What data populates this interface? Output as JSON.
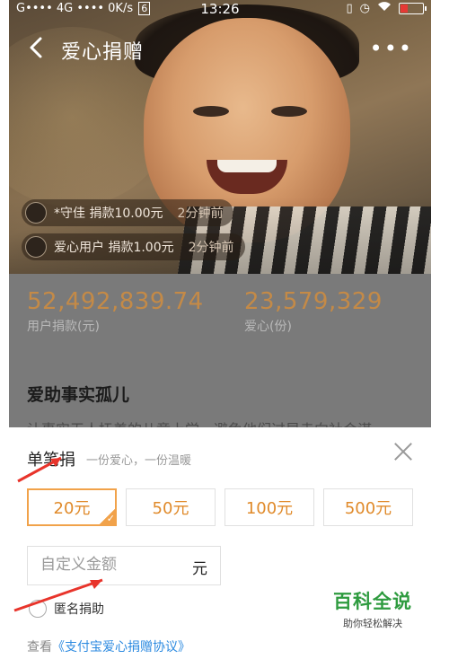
{
  "status_bar": {
    "carrier": "G•••• 4G •••• 0K/s",
    "carrier_badge": "6",
    "time": "13:26",
    "icons": [
      "vibrate-icon",
      "alarm-icon",
      "wifi-icon",
      "battery-icon"
    ],
    "battery_color": "#e53935"
  },
  "navbar": {
    "title": "爱心捐赠",
    "back_icon": "back-chevron-icon",
    "more_label": "•••"
  },
  "feed": [
    {
      "text": "*守佳 捐款10.00元",
      "time": "2分钟前"
    },
    {
      "text": "爱心用户 捐款1.00元",
      "time": "2分钟前"
    }
  ],
  "stats": {
    "donation_total": "52,492,839.74",
    "donation_label": "用户捐款(元)",
    "love_count": "23,579,329",
    "love_label": "爱心(份)",
    "accent_color": "#c48a47"
  },
  "project": {
    "title": "爱助事实孤儿",
    "description": "让事实无人抚养的儿童上学，避免他们过早走向社会谋"
  },
  "sheet": {
    "title": "单笔捐",
    "subtitle": "一份爱心，一份温暖",
    "amounts": [
      {
        "label": "20元",
        "selected": true
      },
      {
        "label": "50元",
        "selected": false
      },
      {
        "label": "100元",
        "selected": false
      },
      {
        "label": "500元",
        "selected": false
      }
    ],
    "custom_placeholder": "自定义金额",
    "custom_value": "",
    "custom_unit": "元",
    "anonymous_label": "匿名捐助",
    "agreement_prefix": "查看",
    "agreement_link": "《支付宝爱心捐赠协议》",
    "accent_color": "#e08a2a",
    "link_color": "#2c8ae0"
  },
  "watermark": {
    "title": "百科全说",
    "subtitle": "助你轻松解决"
  }
}
